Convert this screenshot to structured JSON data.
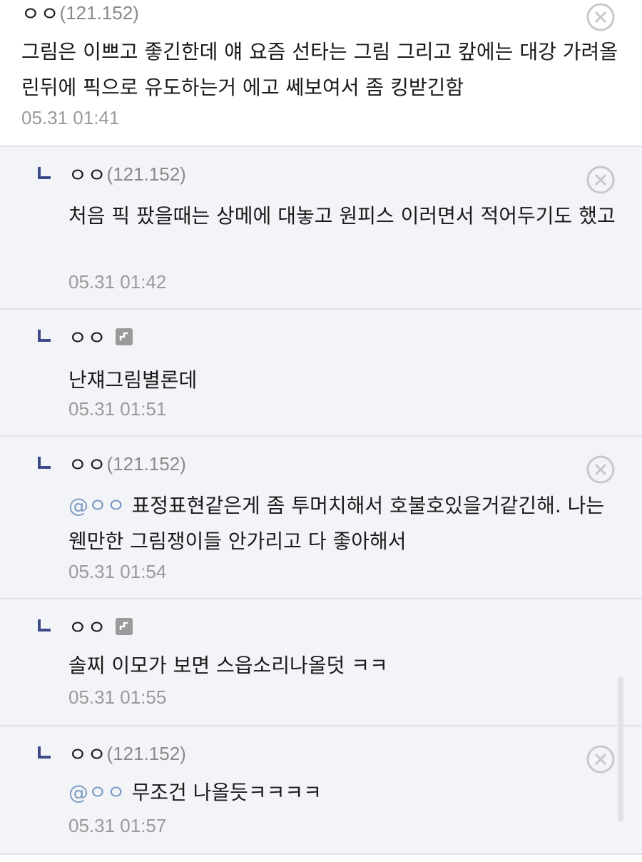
{
  "comments": [
    {
      "nick": "ㅇㅇ",
      "ip": "(121.152)",
      "text": "그림은 이쁘고 좋긴한데 얘 요즘 선타는 그림 그리고 캎에는 대강 가려올린뒤에 픽으로 유도하는거 에고 쎄보여서 좀 킹받긴함",
      "date": "05.31 01:41"
    },
    {
      "nick": "ㅇㅇ",
      "ip": "(121.152)",
      "text": "처음 픽 팠을때는 상메에 대놓고 원피스 이러면서 적어두기도 했고",
      "date": "05.31 01:42"
    },
    {
      "nick": "ㅇㅇ",
      "text": "난쟤그림별론데",
      "date": "05.31 01:51"
    },
    {
      "nick": "ㅇㅇ",
      "ip": "(121.152)",
      "mention": "@ㅇㅇ",
      "text": "표정표현같은게 좀 투머치해서 호불호있을거같긴해. 나는 웬만한 그림쟁이들 안가리고 다 좋아해서",
      "date": "05.31 01:54"
    },
    {
      "nick": "ㅇㅇ",
      "text": "솔찌 이모가 보면 스읍소리나올덧 ㅋㅋ",
      "date": "05.31 01:55"
    },
    {
      "nick": "ㅇㅇ",
      "ip": "(121.152)",
      "mention": "@ㅇㅇ",
      "text": "무조건 나올듯ㅋㅋㅋㅋ",
      "date": "05.31 01:57"
    }
  ],
  "icons": {
    "reply": "reply-arrow-icon",
    "delete": "close-circle-icon",
    "fixed_nick": "fixed-nick-icon"
  },
  "colors": {
    "reply_bg": "#f3f4f8",
    "divider": "#dfe2e8",
    "mention": "#7d9bc3",
    "date": "#9a9a9a",
    "arrow": "#3d4a8a"
  }
}
